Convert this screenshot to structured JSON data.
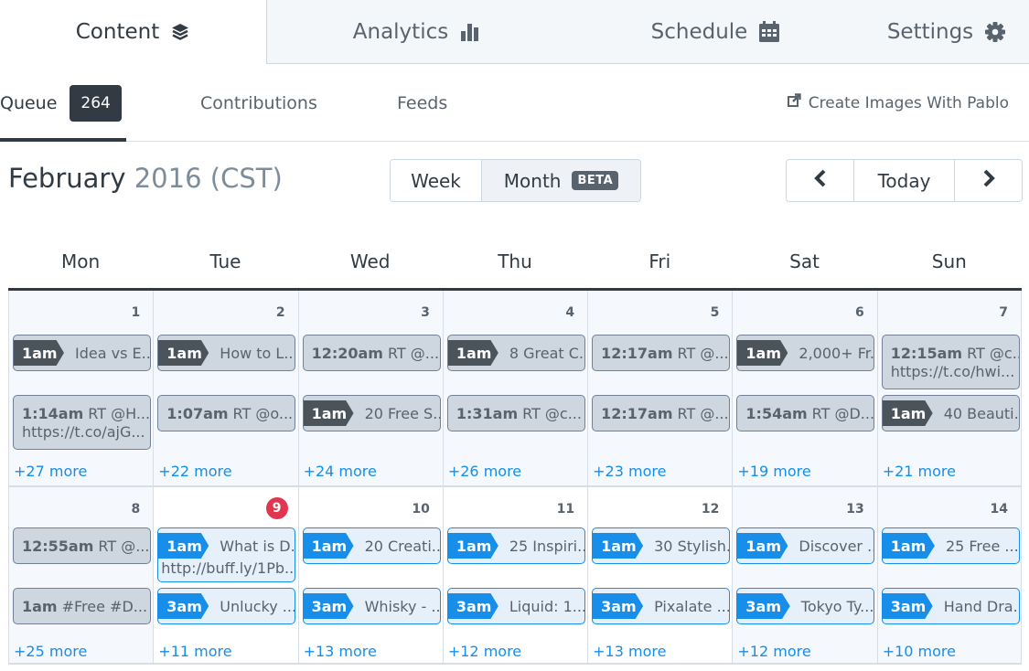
{
  "top_tabs": [
    {
      "label": "Content",
      "icon": "layers-icon",
      "active": true
    },
    {
      "label": "Analytics",
      "icon": "bar-chart-icon",
      "active": false
    },
    {
      "label": "Schedule",
      "icon": "calendar-icon",
      "active": false
    },
    {
      "label": "Settings",
      "icon": "gear-icon",
      "active": false
    }
  ],
  "sub_tabs": {
    "queue": {
      "label": "Queue",
      "count": "264"
    },
    "contributions": {
      "label": "Contributions"
    },
    "feeds": {
      "label": "Feeds"
    },
    "pablo": {
      "label": "Create Images With Pablo",
      "icon": "external-link-icon"
    }
  },
  "calendar_header": {
    "month": "February",
    "year_tz": "2016 (CST)",
    "view_week": "Week",
    "view_month": "Month",
    "beta": "BETA",
    "today": "Today",
    "prev_icon": "chevron-left-icon",
    "next_icon": "chevron-right-icon"
  },
  "days_of_week": [
    "Mon",
    "Tue",
    "Wed",
    "Thu",
    "Fri",
    "Sat",
    "Sun"
  ],
  "weeks": [
    {
      "days": [
        {
          "num": "1",
          "posts": [
            {
              "style": "tag",
              "time": "1am",
              "text": "Idea vs E..."
            },
            {
              "style": "plain",
              "time": "1:14am",
              "text": "RT @H...",
              "line2": "https://t.co/ajG..."
            }
          ],
          "more": "+27 more"
        },
        {
          "num": "2",
          "posts": [
            {
              "style": "tag",
              "time": "1am",
              "text": "How to L..."
            },
            {
              "style": "plain",
              "time": "1:07am",
              "text": "RT @o..."
            }
          ],
          "more": "+22 more"
        },
        {
          "num": "3",
          "posts": [
            {
              "style": "plain",
              "time": "12:20am",
              "text": "RT @..."
            },
            {
              "style": "tag",
              "time": "1am",
              "text": "20 Free S..."
            }
          ],
          "more": "+24 more"
        },
        {
          "num": "4",
          "posts": [
            {
              "style": "tag",
              "time": "1am",
              "text": "8 Great C..."
            },
            {
              "style": "plain",
              "time": "1:31am",
              "text": "RT @c..."
            }
          ],
          "more": "+26 more"
        },
        {
          "num": "5",
          "posts": [
            {
              "style": "plain",
              "time": "12:17am",
              "text": "RT @..."
            },
            {
              "style": "plain",
              "time": "12:17am",
              "text": "RT @..."
            }
          ],
          "more": "+23 more"
        },
        {
          "num": "6",
          "posts": [
            {
              "style": "tag",
              "time": "1am",
              "text": "2,000+ Fr..."
            },
            {
              "style": "plain",
              "time": "1:54am",
              "text": "RT @D..."
            }
          ],
          "more": "+19 more"
        },
        {
          "num": "7",
          "posts": [
            {
              "style": "plain",
              "time": "12:15am",
              "text": "RT @c...",
              "line2": "https://t.co/hwi..."
            },
            {
              "style": "tag",
              "time": "1am",
              "text": "40 Beauti..."
            }
          ],
          "more": "+21 more"
        }
      ]
    },
    {
      "days": [
        {
          "num": "8",
          "posts": [
            {
              "style": "plain",
              "time": "12:55am",
              "text": "RT @..."
            },
            {
              "style": "plain",
              "time": "1am",
              "text": "#Free #D..."
            }
          ],
          "more": "+25 more"
        },
        {
          "num": "9",
          "today": true,
          "posts": [
            {
              "style": "tag-blue",
              "time": "1am",
              "text": "What is D...",
              "line2": "http://buff.ly/1Pb..."
            },
            {
              "style": "tag-blue",
              "time": "3am",
              "text": "Unlucky ..."
            }
          ],
          "more": "+11 more"
        },
        {
          "num": "10",
          "posts": [
            {
              "style": "tag-blue",
              "time": "1am",
              "text": "20 Creati..."
            },
            {
              "style": "tag-blue",
              "time": "3am",
              "text": "Whisky - ..."
            }
          ],
          "more": "+13 more"
        },
        {
          "num": "11",
          "posts": [
            {
              "style": "tag-blue",
              "time": "1am",
              "text": "25 Inspiri..."
            },
            {
              "style": "tag-blue",
              "time": "3am",
              "text": "Liquid: 1..."
            }
          ],
          "more": "+12 more"
        },
        {
          "num": "12",
          "posts": [
            {
              "style": "tag-blue",
              "time": "1am",
              "text": "30 Stylish..."
            },
            {
              "style": "tag-blue",
              "time": "3am",
              "text": "Pixalate ..."
            }
          ],
          "more": "+13 more"
        },
        {
          "num": "13",
          "posts": [
            {
              "style": "tag-blue",
              "time": "1am",
              "text": "Discover ..."
            },
            {
              "style": "tag-blue",
              "time": "3am",
              "text": "Tokyo Ty..."
            }
          ],
          "more": "+12 more"
        },
        {
          "num": "14",
          "posts": [
            {
              "style": "tag-blue",
              "time": "1am",
              "text": "25 Free ..."
            },
            {
              "style": "tag-blue",
              "time": "3am",
              "text": "Hand Dra..."
            }
          ],
          "more": "+10 more"
        }
      ]
    }
  ],
  "colors": {
    "accent_blue": "#168eea",
    "dark": "#323b43",
    "today_badge": "#e0364f"
  }
}
